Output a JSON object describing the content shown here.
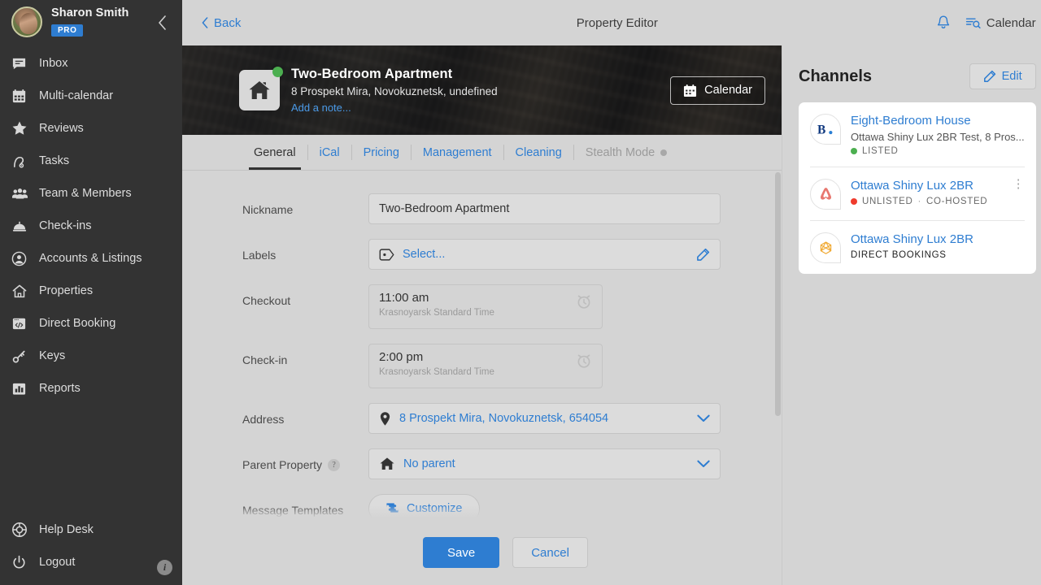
{
  "sidebar": {
    "user": {
      "name": "Sharon Smith",
      "badge": "PRO",
      "avatar_icon": "user-avatar",
      "collapse_icon": "chevron-left-icon"
    },
    "items": [
      {
        "label": "Inbox",
        "icon": "inbox-chat-icon"
      },
      {
        "label": "Multi-calendar",
        "icon": "calendar-grid-icon"
      },
      {
        "label": "Reviews",
        "icon": "star-icon"
      },
      {
        "label": "Tasks",
        "icon": "vacuum-icon"
      },
      {
        "label": "Team & Members",
        "icon": "people-group-icon"
      },
      {
        "label": "Check-ins",
        "icon": "bell-desk-icon"
      },
      {
        "label": "Accounts & Listings",
        "icon": "user-circle-icon"
      },
      {
        "label": "Properties",
        "icon": "home-outline-icon"
      },
      {
        "label": "Direct Booking",
        "icon": "code-window-icon"
      },
      {
        "label": "Keys",
        "icon": "key-icon"
      },
      {
        "label": "Reports",
        "icon": "bar-chart-icon"
      }
    ],
    "bottom_items": [
      {
        "label": "Help Desk",
        "icon": "lifebuoy-icon"
      },
      {
        "label": "Logout",
        "icon": "power-icon"
      }
    ],
    "info_badge": "i"
  },
  "topbar": {
    "back_label": "Back",
    "title": "Property Editor",
    "bell_icon": "notification-bell-icon",
    "calendar_label": "Calendar",
    "calendar_icon": "calendar-search-icon"
  },
  "hero": {
    "property_title": "Two-Bedroom Apartment",
    "property_address": "8 Prospekt Mira, Novokuznetsk, undefined",
    "add_note_label": "Add a note...",
    "calendar_button_label": "Calendar",
    "thumb_icon": "home-icon",
    "status_dot_color": "#4caf50"
  },
  "tabs": [
    {
      "label": "General",
      "state": "active"
    },
    {
      "label": "iCal",
      "state": "default"
    },
    {
      "label": "Pricing",
      "state": "default"
    },
    {
      "label": "Management",
      "state": "default"
    },
    {
      "label": "Cleaning",
      "state": "default"
    },
    {
      "label": "Stealth Mode",
      "state": "disabled"
    }
  ],
  "form": {
    "nickname": {
      "label": "Nickname",
      "value": "Two-Bedroom Apartment"
    },
    "labels": {
      "label": "Labels",
      "value": "Select...",
      "lead_icon": "tag-icon",
      "trail_icon": "pencil-icon"
    },
    "checkout": {
      "label": "Checkout",
      "value": "11:00 am",
      "timezone": "Krasnoyarsk Standard Time",
      "icon": "alarm-clock-icon"
    },
    "checkin": {
      "label": "Check-in",
      "value": "2:00 pm",
      "timezone": "Krasnoyarsk Standard Time",
      "icon": "alarm-clock-icon"
    },
    "address": {
      "label": "Address",
      "value": "8 Prospekt Mira, Novokuznetsk, 654054",
      "lead_icon": "map-pin-icon",
      "trail_icon": "chevron-down-icon"
    },
    "parent_property": {
      "label": "Parent Property",
      "value": "No parent",
      "lead_icon": "home-icon",
      "trail_icon": "chevron-down-icon",
      "help_icon": "help-question-icon"
    },
    "message_templates": {
      "label": "Message Templates",
      "button_label": "Customize",
      "icon": "puzzle-icon"
    }
  },
  "footer": {
    "save_label": "Save",
    "cancel_label": "Cancel"
  },
  "channels": {
    "title": "Channels",
    "edit_label": "Edit",
    "edit_icon": "pencil-icon",
    "items": [
      {
        "logo_icon": "booking-com-icon",
        "name": "Eight-Bedroom House",
        "subtitle": "Ottawa Shiny Lux 2BR Test, 8 Pros...",
        "status": "LISTED",
        "status_color": "#4caf50",
        "extra": "",
        "kebab": false
      },
      {
        "logo_icon": "airbnb-icon",
        "name": "Ottawa Shiny Lux 2BR",
        "subtitle": "",
        "status": "UNLISTED",
        "status_color": "#ef3b2d",
        "extra": "CO-HOSTED",
        "kebab": true
      },
      {
        "logo_icon": "direct-booking-icon",
        "name": "Ottawa Shiny Lux 2BR",
        "subtitle": "",
        "status": "DIRECT BOOKINGS",
        "status_color": "",
        "extra": "",
        "kebab": false
      }
    ]
  },
  "colors": {
    "accent_blue": "#2e7dd1",
    "page_bg": "#d4d4d4",
    "sidebar_bg": "#333333"
  }
}
